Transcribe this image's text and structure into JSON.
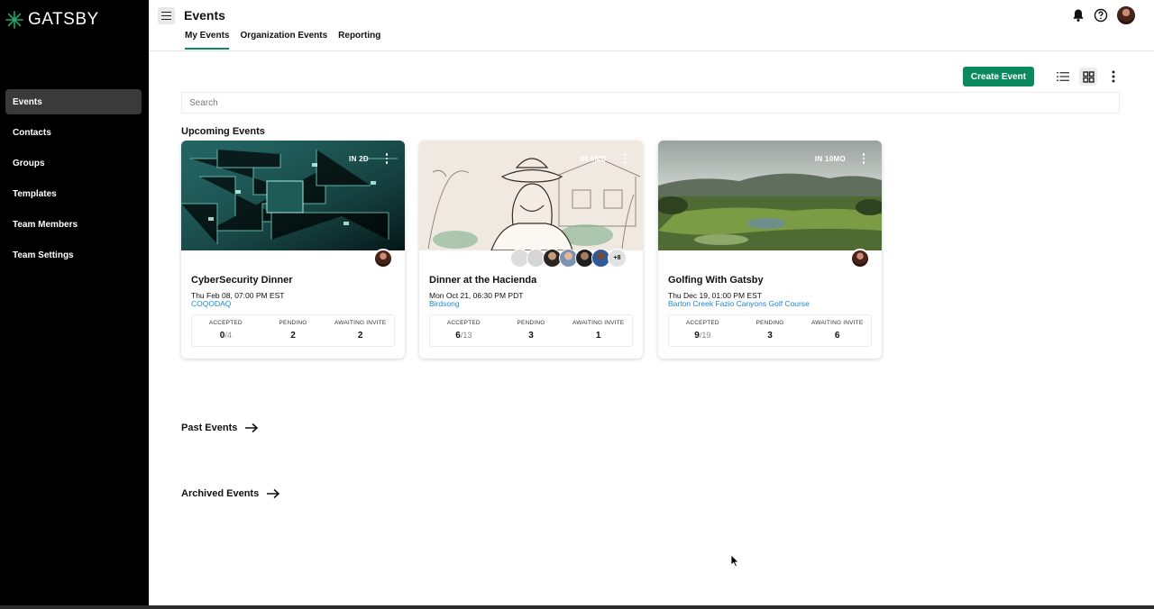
{
  "app": {
    "brand": "GATSBY",
    "brand_color": "#0b8a5f"
  },
  "sidebar": {
    "items": [
      {
        "label": "Events",
        "active": true
      },
      {
        "label": "Contacts"
      },
      {
        "label": "Groups"
      },
      {
        "label": "Templates"
      },
      {
        "label": "Team Members"
      },
      {
        "label": "Team Settings"
      }
    ]
  },
  "header": {
    "title": "Events",
    "tabs": [
      {
        "label": "My Events",
        "active": true
      },
      {
        "label": "Organization Events"
      },
      {
        "label": "Reporting"
      }
    ],
    "icons": [
      "bell-icon",
      "help-icon",
      "user-avatar"
    ]
  },
  "toolbar": {
    "create_label": "Create Event",
    "view_modes": [
      "list-view-icon",
      "grid-view-icon",
      "more-vert-icon"
    ],
    "active_view": "grid"
  },
  "search": {
    "placeholder": "Search",
    "value": ""
  },
  "sections": {
    "upcoming": "Upcoming Events",
    "past": "Past Events",
    "archived": "Archived Events"
  },
  "events": [
    {
      "badge": "IN 2D",
      "title": "CyberSecurity Dinner",
      "date": "Thu Feb 08, 07:00 PM EST",
      "location": "COQODAQ",
      "accepted": "0",
      "accepted_total": "/4",
      "pending": "2",
      "awaiting": "2"
    },
    {
      "badge": "IN 8MO",
      "title": "Dinner at the Hacienda",
      "date": "Mon Oct 21, 06:30 PM PDT",
      "location": "Birdsong",
      "accepted": "6",
      "accepted_total": "/13",
      "pending": "3",
      "awaiting": "1",
      "more_attendees": "+8"
    },
    {
      "badge": "IN 10MO",
      "title": "Golfing With Gatsby",
      "date": "Thu Dec 19, 01:00 PM EST",
      "location": "Barton Creek Fazio Canyons Golf Course",
      "accepted": "9",
      "accepted_total": "/19",
      "pending": "3",
      "awaiting": "6"
    }
  ],
  "stat_labels": {
    "accepted": "ACCEPTED",
    "pending": "PENDING",
    "awaiting": "AWAITING INVITE"
  }
}
